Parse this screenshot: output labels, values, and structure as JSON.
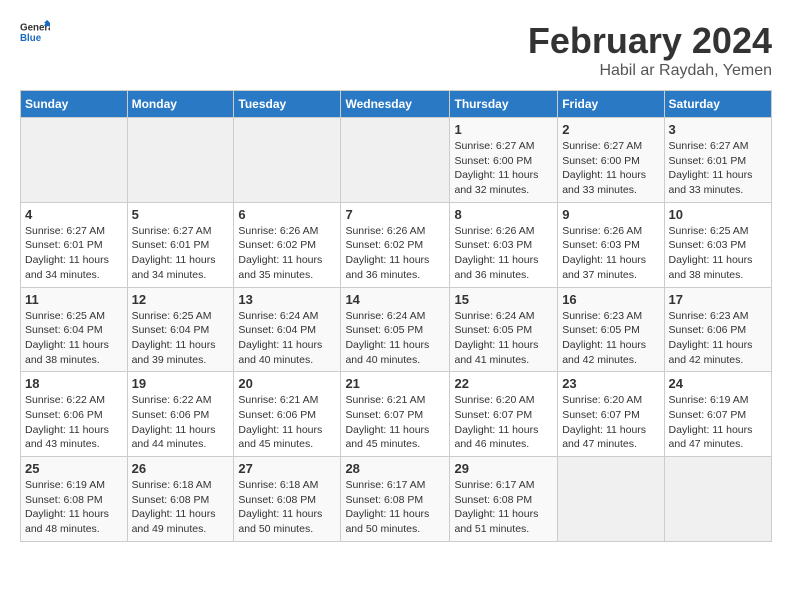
{
  "header": {
    "logo_general": "General",
    "logo_blue": "Blue",
    "title": "February 2024",
    "subtitle": "Habil ar Raydah, Yemen"
  },
  "weekdays": [
    "Sunday",
    "Monday",
    "Tuesday",
    "Wednesday",
    "Thursday",
    "Friday",
    "Saturday"
  ],
  "weeks": [
    [
      {
        "day": "",
        "info": ""
      },
      {
        "day": "",
        "info": ""
      },
      {
        "day": "",
        "info": ""
      },
      {
        "day": "",
        "info": ""
      },
      {
        "day": "1",
        "info": "Sunrise: 6:27 AM\nSunset: 6:00 PM\nDaylight: 11 hours and 32 minutes."
      },
      {
        "day": "2",
        "info": "Sunrise: 6:27 AM\nSunset: 6:00 PM\nDaylight: 11 hours and 33 minutes."
      },
      {
        "day": "3",
        "info": "Sunrise: 6:27 AM\nSunset: 6:01 PM\nDaylight: 11 hours and 33 minutes."
      }
    ],
    [
      {
        "day": "4",
        "info": "Sunrise: 6:27 AM\nSunset: 6:01 PM\nDaylight: 11 hours and 34 minutes."
      },
      {
        "day": "5",
        "info": "Sunrise: 6:27 AM\nSunset: 6:01 PM\nDaylight: 11 hours and 34 minutes."
      },
      {
        "day": "6",
        "info": "Sunrise: 6:26 AM\nSunset: 6:02 PM\nDaylight: 11 hours and 35 minutes."
      },
      {
        "day": "7",
        "info": "Sunrise: 6:26 AM\nSunset: 6:02 PM\nDaylight: 11 hours and 36 minutes."
      },
      {
        "day": "8",
        "info": "Sunrise: 6:26 AM\nSunset: 6:03 PM\nDaylight: 11 hours and 36 minutes."
      },
      {
        "day": "9",
        "info": "Sunrise: 6:26 AM\nSunset: 6:03 PM\nDaylight: 11 hours and 37 minutes."
      },
      {
        "day": "10",
        "info": "Sunrise: 6:25 AM\nSunset: 6:03 PM\nDaylight: 11 hours and 38 minutes."
      }
    ],
    [
      {
        "day": "11",
        "info": "Sunrise: 6:25 AM\nSunset: 6:04 PM\nDaylight: 11 hours and 38 minutes."
      },
      {
        "day": "12",
        "info": "Sunrise: 6:25 AM\nSunset: 6:04 PM\nDaylight: 11 hours and 39 minutes."
      },
      {
        "day": "13",
        "info": "Sunrise: 6:24 AM\nSunset: 6:04 PM\nDaylight: 11 hours and 40 minutes."
      },
      {
        "day": "14",
        "info": "Sunrise: 6:24 AM\nSunset: 6:05 PM\nDaylight: 11 hours and 40 minutes."
      },
      {
        "day": "15",
        "info": "Sunrise: 6:24 AM\nSunset: 6:05 PM\nDaylight: 11 hours and 41 minutes."
      },
      {
        "day": "16",
        "info": "Sunrise: 6:23 AM\nSunset: 6:05 PM\nDaylight: 11 hours and 42 minutes."
      },
      {
        "day": "17",
        "info": "Sunrise: 6:23 AM\nSunset: 6:06 PM\nDaylight: 11 hours and 42 minutes."
      }
    ],
    [
      {
        "day": "18",
        "info": "Sunrise: 6:22 AM\nSunset: 6:06 PM\nDaylight: 11 hours and 43 minutes."
      },
      {
        "day": "19",
        "info": "Sunrise: 6:22 AM\nSunset: 6:06 PM\nDaylight: 11 hours and 44 minutes."
      },
      {
        "day": "20",
        "info": "Sunrise: 6:21 AM\nSunset: 6:06 PM\nDaylight: 11 hours and 45 minutes."
      },
      {
        "day": "21",
        "info": "Sunrise: 6:21 AM\nSunset: 6:07 PM\nDaylight: 11 hours and 45 minutes."
      },
      {
        "day": "22",
        "info": "Sunrise: 6:20 AM\nSunset: 6:07 PM\nDaylight: 11 hours and 46 minutes."
      },
      {
        "day": "23",
        "info": "Sunrise: 6:20 AM\nSunset: 6:07 PM\nDaylight: 11 hours and 47 minutes."
      },
      {
        "day": "24",
        "info": "Sunrise: 6:19 AM\nSunset: 6:07 PM\nDaylight: 11 hours and 47 minutes."
      }
    ],
    [
      {
        "day": "25",
        "info": "Sunrise: 6:19 AM\nSunset: 6:08 PM\nDaylight: 11 hours and 48 minutes."
      },
      {
        "day": "26",
        "info": "Sunrise: 6:18 AM\nSunset: 6:08 PM\nDaylight: 11 hours and 49 minutes."
      },
      {
        "day": "27",
        "info": "Sunrise: 6:18 AM\nSunset: 6:08 PM\nDaylight: 11 hours and 50 minutes."
      },
      {
        "day": "28",
        "info": "Sunrise: 6:17 AM\nSunset: 6:08 PM\nDaylight: 11 hours and 50 minutes."
      },
      {
        "day": "29",
        "info": "Sunrise: 6:17 AM\nSunset: 6:08 PM\nDaylight: 11 hours and 51 minutes."
      },
      {
        "day": "",
        "info": ""
      },
      {
        "day": "",
        "info": ""
      }
    ]
  ]
}
